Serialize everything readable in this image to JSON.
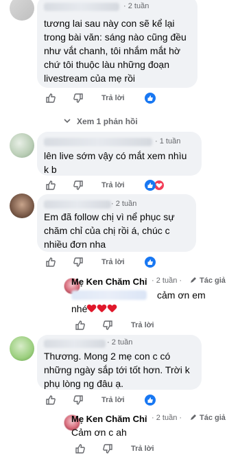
{
  "comments": [
    {
      "time": "2 tuần",
      "text_lines": [
        "tương lai sau này con sẽ kể lại",
        "trong bài văn: sáng nào cũng đều",
        "như vắt chanh, tôi nhắm mắt hờ",
        "chứ tôi thuộc làu những đoạn",
        "livestream của mẹ rồi"
      ],
      "reply_label": "Trả lời",
      "reactions": [
        "like"
      ]
    },
    {
      "time": "1 tuần",
      "text_lines": [
        "lên live sớm vậy có mắt xem nhìu",
        "k b"
      ],
      "reply_label": "Trả lời",
      "reactions": [
        "like",
        "love"
      ]
    },
    {
      "time": "2 tuần",
      "text_lines": [
        "Em đã follow chị vì nể phục sự",
        "chăm chỉ của chị rồi á, chúc c",
        "nhiều đơn nha"
      ],
      "reply_label": "Trả lời",
      "reactions": [
        "like"
      ]
    },
    {
      "time": "2 tuần",
      "text_lines": [
        "Thương. Mong 2 mẹ con c có",
        "những ngày sắp tới tốt hơn. Trời k",
        "phụ lòng ng đâu ạ."
      ],
      "reply_label": "Trả lời",
      "reactions": [
        "like"
      ]
    }
  ],
  "view_replies": "Xem 1 phản hồi",
  "page_replies": [
    {
      "author": "Mẹ Ken Chăm Chỉ",
      "time": "2 tuần",
      "badge": "Tác giả",
      "text_part1": "cảm ơn em",
      "text_part2": "nhé",
      "reply_label": "Trả lời"
    },
    {
      "author": "Mẹ Ken Chăm Chỉ",
      "time": "2 tuần",
      "badge": "Tác giả",
      "text": "Cảm ơn c ah",
      "reply_label": "Trả lời"
    }
  ],
  "separator": "·",
  "colors": {
    "like": "#1877f2",
    "love": "#f33e58",
    "heart": "#e0182b",
    "meta": "#65676b",
    "bubble": "#f0f2f5"
  },
  "icons": [
    "thumbs-up-icon",
    "thumbs-down-icon",
    "like-reaction-icon",
    "love-reaction-icon",
    "chevron-down-icon",
    "pencil-icon",
    "heart-icon"
  ]
}
